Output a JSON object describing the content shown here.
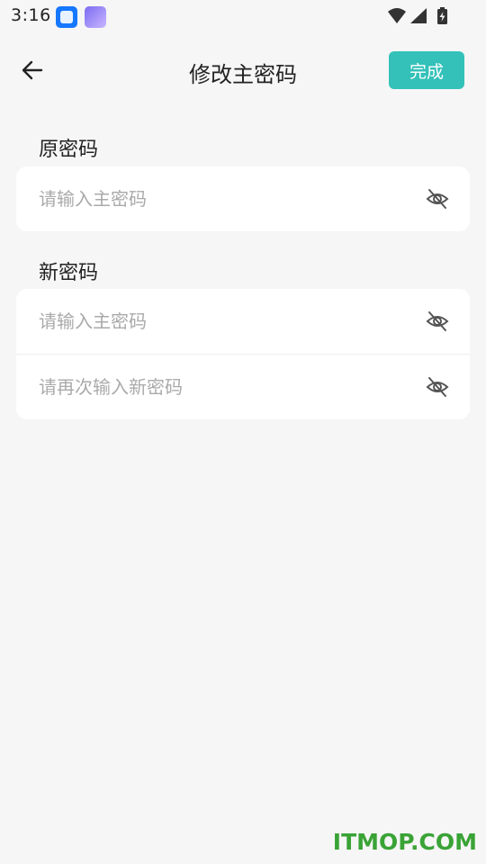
{
  "status_bar": {
    "time": "3:16",
    "icons": [
      "app-notification-icon",
      "game-app-icon",
      "wifi-icon",
      "cellular-signal-icon",
      "battery-charging-icon"
    ]
  },
  "header": {
    "title": "修改主密码",
    "back_icon": "arrow-left-icon",
    "done_label": "完成"
  },
  "sections": {
    "original": {
      "label": "原密码",
      "fields": [
        {
          "placeholder": "请输入主密码",
          "value": "",
          "icon": "eye-off-icon"
        }
      ]
    },
    "new": {
      "label": "新密码",
      "fields": [
        {
          "placeholder": "请输入主密码",
          "value": "",
          "icon": "eye-off-icon"
        },
        {
          "placeholder": "请再次输入新密码",
          "value": "",
          "icon": "eye-off-icon"
        }
      ]
    }
  },
  "colors": {
    "accent": "#33c1b9",
    "background": "#f6f6f6",
    "card": "#ffffff",
    "placeholder": "#aaaaaa",
    "watermark": "#3aa336"
  },
  "watermark": "ITMOP.COM"
}
